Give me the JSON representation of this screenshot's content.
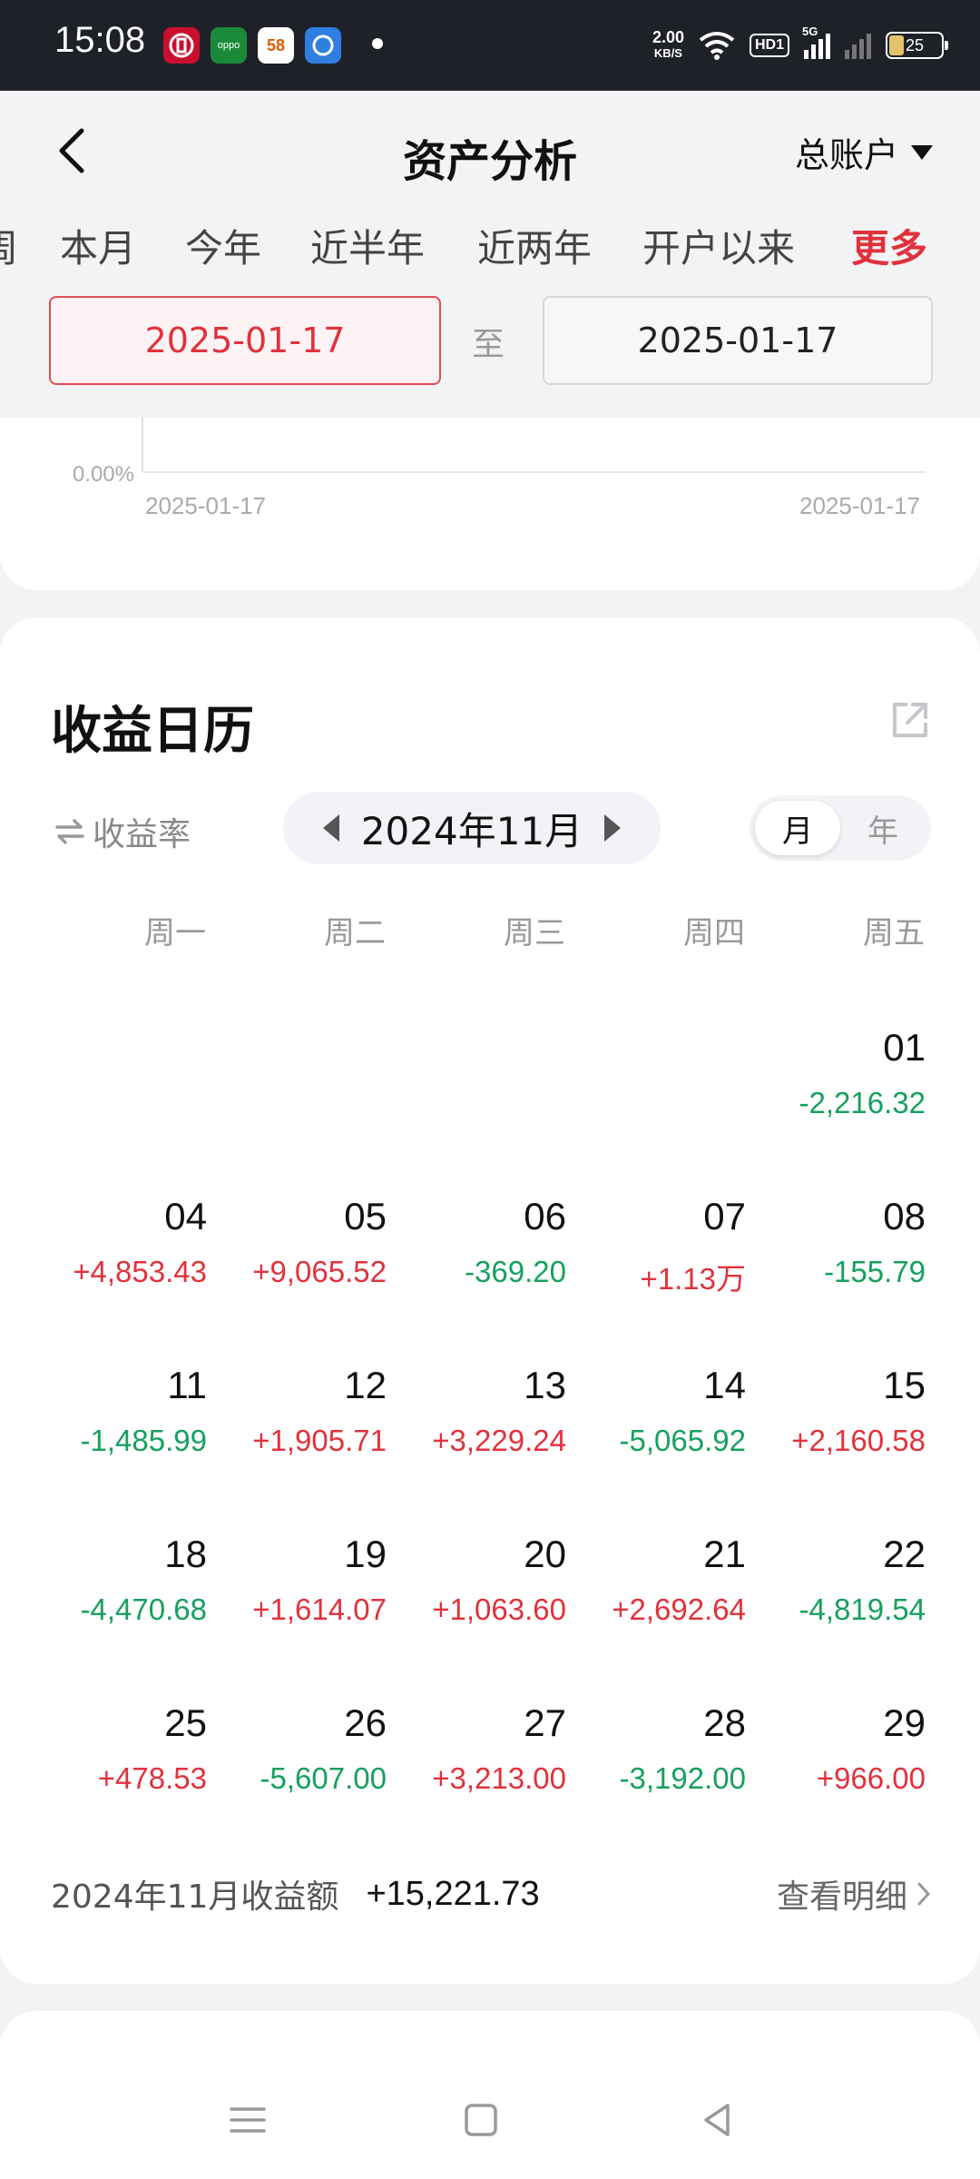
{
  "status_bar": {
    "time": "15:08",
    "net_speed_value": "2.00",
    "net_speed_unit": "KB/S",
    "hd": "HD1",
    "signal_label": "5G",
    "battery": "25",
    "app_icons": [
      "bank-icon",
      "oppo-icon",
      "58-icon",
      "app-icon"
    ]
  },
  "header": {
    "title": "资产分析",
    "account": "总账户"
  },
  "tabs": [
    "周",
    "本月",
    "今年",
    "近半年",
    "近两年",
    "开户以来",
    "更多"
  ],
  "date_range": {
    "start": "2025-01-17",
    "separator": "至",
    "end": "2025-01-17"
  },
  "chart_data": {
    "type": "line",
    "x": [
      "2025-01-17",
      "2025-01-17"
    ],
    "ytick": "0.00%",
    "series": []
  },
  "calendar": {
    "title": "收益日历",
    "rate_toggle": "收益率",
    "month": "2024年11月",
    "view_month": "月",
    "view_year": "年",
    "weekdays": [
      "周一",
      "周二",
      "周三",
      "周四",
      "周五"
    ],
    "rows": [
      [
        null,
        null,
        null,
        null,
        {
          "day": "01",
          "value": "-2,216.32",
          "sign": "neg"
        }
      ],
      [
        {
          "day": "04",
          "value": "+4,853.43",
          "sign": "pos"
        },
        {
          "day": "05",
          "value": "+9,065.52",
          "sign": "pos"
        },
        {
          "day": "06",
          "value": "-369.20",
          "sign": "neg"
        },
        {
          "day": "07",
          "value": "+1.13万",
          "sign": "pos"
        },
        {
          "day": "08",
          "value": "-155.79",
          "sign": "neg"
        }
      ],
      [
        {
          "day": "11",
          "value": "-1,485.99",
          "sign": "neg"
        },
        {
          "day": "12",
          "value": "+1,905.71",
          "sign": "pos"
        },
        {
          "day": "13",
          "value": "+3,229.24",
          "sign": "pos"
        },
        {
          "day": "14",
          "value": "-5,065.92",
          "sign": "neg"
        },
        {
          "day": "15",
          "value": "+2,160.58",
          "sign": "pos"
        }
      ],
      [
        {
          "day": "18",
          "value": "-4,470.68",
          "sign": "neg"
        },
        {
          "day": "19",
          "value": "+1,614.07",
          "sign": "pos"
        },
        {
          "day": "20",
          "value": "+1,063.60",
          "sign": "pos"
        },
        {
          "day": "21",
          "value": "+2,692.64",
          "sign": "pos"
        },
        {
          "day": "22",
          "value": "-4,819.54",
          "sign": "neg"
        }
      ],
      [
        {
          "day": "25",
          "value": "+478.53",
          "sign": "pos"
        },
        {
          "day": "26",
          "value": "-5,607.00",
          "sign": "neg"
        },
        {
          "day": "27",
          "value": "+3,213.00",
          "sign": "pos"
        },
        {
          "day": "28",
          "value": "-3,192.00",
          "sign": "neg"
        },
        {
          "day": "29",
          "value": "+966.00",
          "sign": "pos"
        }
      ]
    ],
    "summary_label": "2024年11月收益额",
    "summary_value": "+15,221.73",
    "detail_link": "查看明细"
  },
  "colors": {
    "positive": "#e0323c",
    "negative": "#16a05e",
    "accent": "#e0323c"
  }
}
